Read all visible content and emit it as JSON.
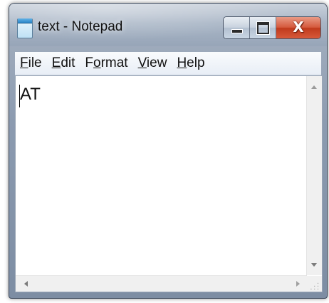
{
  "window": {
    "title": "text - Notepad",
    "app_icon": "notepad-icon"
  },
  "caption_buttons": {
    "minimize_icon": "minimize-icon",
    "maximize_icon": "maximize-icon",
    "close_icon": "close-icon",
    "close_glyph": "X",
    "close_color": "#c7432a"
  },
  "menu": {
    "items": [
      {
        "before": "",
        "key": "F",
        "after": "ile"
      },
      {
        "before": "",
        "key": "E",
        "after": "dit"
      },
      {
        "before": "F",
        "key": "o",
        "after": "rmat"
      },
      {
        "before": "",
        "key": "V",
        "after": "iew"
      },
      {
        "before": "",
        "key": "H",
        "after": "elp"
      }
    ]
  },
  "editor": {
    "content": "AT"
  },
  "scrollbars": {
    "up_icon": "scroll-up-arrow-icon",
    "down_icon": "scroll-down-arrow-icon",
    "left_icon": "scroll-left-arrow-icon",
    "right_icon": "scroll-right-arrow-icon",
    "grip_icon": "size-grip-icon"
  }
}
